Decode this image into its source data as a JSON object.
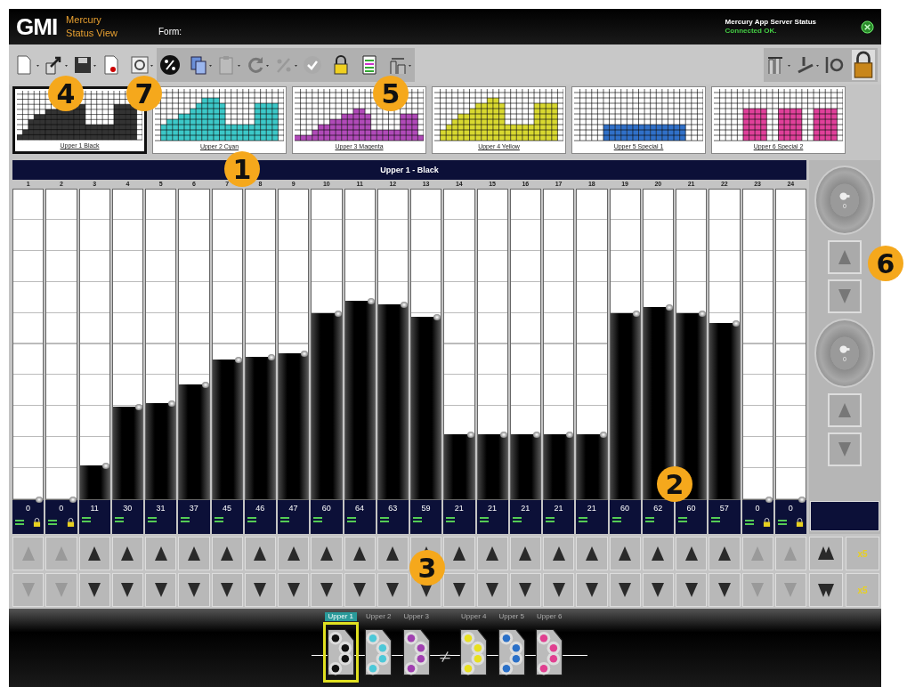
{
  "header": {
    "logo": "GMI",
    "app": "Mercury",
    "view": "Status View",
    "form_label": "Form:",
    "server_label": "Mercury App Server Status",
    "server_status": "Connected OK."
  },
  "thumbnails": [
    {
      "label": "Upper 1 Black",
      "color": "#333333",
      "selected": true
    },
    {
      "label": "Upper 2 Cyan",
      "color": "#3cc8c8",
      "selected": false
    },
    {
      "label": "Upper 3 Magenta",
      "color": "#b04ab8",
      "selected": false
    },
    {
      "label": "Upper 4 Yellow",
      "color": "#d8d830",
      "selected": false
    },
    {
      "label": "Upper 5 Special 1",
      "color": "#3070c8",
      "selected": false
    },
    {
      "label": "Upper 6 Special 2",
      "color": "#e0409a",
      "selected": false
    }
  ],
  "zone_title": "Upper 1 - Black",
  "zones": [
    {
      "number": "1",
      "value": "0",
      "level": 0,
      "locked": true
    },
    {
      "number": "2",
      "value": "0",
      "level": 0,
      "locked": true
    },
    {
      "number": "3",
      "value": "11",
      "level": 0.11,
      "locked": false
    },
    {
      "number": "4",
      "value": "30",
      "level": 0.3,
      "locked": false
    },
    {
      "number": "5",
      "value": "31",
      "level": 0.31,
      "locked": false
    },
    {
      "number": "6",
      "value": "37",
      "level": 0.37,
      "locked": false
    },
    {
      "number": "7",
      "value": "45",
      "level": 0.45,
      "locked": false
    },
    {
      "number": "8",
      "value": "46",
      "level": 0.46,
      "locked": false
    },
    {
      "number": "9",
      "value": "47",
      "level": 0.47,
      "locked": false
    },
    {
      "number": "10",
      "value": "60",
      "level": 0.6,
      "locked": false
    },
    {
      "number": "11",
      "value": "64",
      "level": 0.64,
      "locked": false
    },
    {
      "number": "12",
      "value": "63",
      "level": 0.63,
      "locked": false
    },
    {
      "number": "13",
      "value": "59",
      "level": 0.59,
      "locked": false
    },
    {
      "number": "14",
      "value": "21",
      "level": 0.21,
      "locked": false
    },
    {
      "number": "15",
      "value": "21",
      "level": 0.21,
      "locked": false
    },
    {
      "number": "16",
      "value": "21",
      "level": 0.21,
      "locked": false
    },
    {
      "number": "17",
      "value": "21",
      "level": 0.21,
      "locked": false
    },
    {
      "number": "18",
      "value": "21",
      "level": 0.21,
      "locked": false
    },
    {
      "number": "19",
      "value": "60",
      "level": 0.6,
      "locked": false
    },
    {
      "number": "20",
      "value": "62",
      "level": 0.62,
      "locked": false
    },
    {
      "number": "21",
      "value": "60",
      "level": 0.6,
      "locked": false
    },
    {
      "number": "22",
      "value": "57",
      "level": 0.57,
      "locked": false
    },
    {
      "number": "23",
      "value": "0",
      "level": 0,
      "locked": true
    },
    {
      "number": "24",
      "value": "0",
      "level": 0,
      "locked": true
    }
  ],
  "dials": [
    {
      "value": "0"
    },
    {
      "value": "0"
    }
  ],
  "step_buttons": [
    "x5",
    "x5"
  ],
  "units": [
    {
      "label": "Upper 1",
      "color": "#111111",
      "selected": true
    },
    {
      "label": "Upper 2",
      "color": "#4cc8d8",
      "selected": false
    },
    {
      "label": "Upper 3",
      "color": "#a040b0",
      "selected": false
    },
    {
      "label": "Upper 4",
      "color": "#e8e020",
      "selected": false
    },
    {
      "label": "Upper 5",
      "color": "#2a70c8",
      "selected": false
    },
    {
      "label": "Upper 6",
      "color": "#e04090",
      "selected": false
    }
  ],
  "callouts": [
    "4",
    "7",
    "5",
    "1",
    "2",
    "3",
    "6"
  ]
}
